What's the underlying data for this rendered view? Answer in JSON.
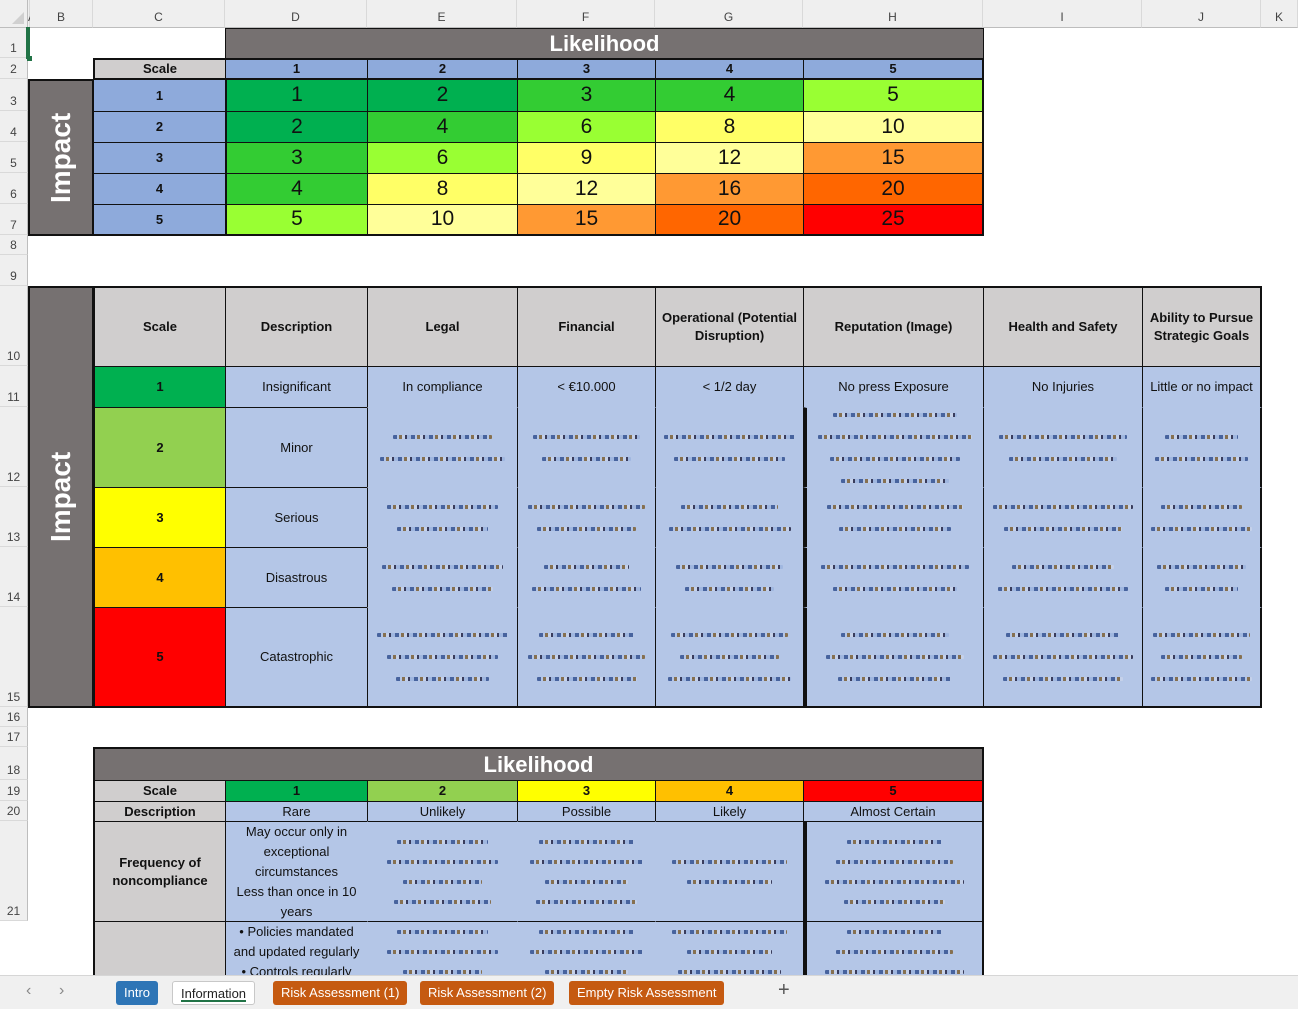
{
  "spreadsheet": {
    "columns": [
      "A",
      "B",
      "C",
      "D",
      "E",
      "F",
      "G",
      "H",
      "I",
      "J",
      "K"
    ],
    "rows": [
      "1",
      "2",
      "3",
      "4",
      "5",
      "6",
      "7",
      "8",
      "9",
      "10",
      "11",
      "12",
      "13",
      "14",
      "15",
      "16",
      "17",
      "18",
      "19",
      "20",
      "21"
    ],
    "selected_cell": "A1"
  },
  "risk_matrix": {
    "title": "Likelihood",
    "side_title": "Impact",
    "scale_label": "Scale",
    "likelihood_scale": [
      "1",
      "2",
      "3",
      "4",
      "5"
    ],
    "impact_scale": [
      "1",
      "2",
      "3",
      "4",
      "5"
    ],
    "values": [
      [
        "1",
        "2",
        "3",
        "4",
        "5"
      ],
      [
        "2",
        "4",
        "6",
        "8",
        "10"
      ],
      [
        "3",
        "6",
        "9",
        "12",
        "15"
      ],
      [
        "4",
        "8",
        "12",
        "16",
        "20"
      ],
      [
        "5",
        "10",
        "15",
        "20",
        "25"
      ]
    ],
    "colors": [
      [
        "#00b050",
        "#00b050",
        "#33cc33",
        "#33cc33",
        "#99ff33"
      ],
      [
        "#00b050",
        "#33cc33",
        "#99ff33",
        "#ffff66",
        "#ffff99"
      ],
      [
        "#33cc33",
        "#99ff33",
        "#ffff66",
        "#ffff99",
        "#ff9933"
      ],
      [
        "#33cc33",
        "#ffff66",
        "#ffff99",
        "#ff9933",
        "#ff6600"
      ],
      [
        "#99ff33",
        "#ffff99",
        "#ff9933",
        "#ff6600",
        "#ff0000"
      ]
    ]
  },
  "impact_table": {
    "side_title": "Impact",
    "headers": [
      "Scale",
      "Description",
      "Legal",
      "Financial",
      "Operational (Potential Disruption)",
      "Reputation (Image)",
      "Health and Safety",
      "Ability to Pursue Strategic Goals"
    ],
    "rows": [
      {
        "scale": "1",
        "color": "#00b050",
        "description": "Insignificant",
        "legal": "In compliance",
        "financial": "< €10.000",
        "operational": "< 1/2 day",
        "reputation": "No press Exposure",
        "health_safety": "No Injuries",
        "strategic": "Little or no impact"
      },
      {
        "scale": "2",
        "color": "#92d050",
        "description": "Minor"
      },
      {
        "scale": "3",
        "color": "#ffff00",
        "description": "Serious"
      },
      {
        "scale": "4",
        "color": "#ffc000",
        "description": "Disastrous"
      },
      {
        "scale": "5",
        "color": "#ff0000",
        "description": "Catastrophic"
      }
    ]
  },
  "likelihood_table": {
    "title": "Likelihood",
    "scale_label": "Scale",
    "description_label": "Description",
    "frequency_label": "Frequency of noncompliance",
    "levels": [
      {
        "scale": "1",
        "color": "#00b050",
        "description": "Rare",
        "frequency": "May occur only in exceptional circumstances\nLess than once in 10 years",
        "controls": "• Policies mandated and updated regularly\n• Controls regularly"
      },
      {
        "scale": "2",
        "color": "#92d050",
        "description": "Unlikely"
      },
      {
        "scale": "3",
        "color": "#ffff00",
        "description": "Possible"
      },
      {
        "scale": "4",
        "color": "#ffc000",
        "description": "Likely"
      },
      {
        "scale": "5",
        "color": "#ff0000",
        "description": "Almost Certain"
      }
    ]
  },
  "sheet_tabs": {
    "prev_label": "‹",
    "next_label": "›",
    "tabs": [
      {
        "label": "Intro",
        "style": "blue"
      },
      {
        "label": "Information",
        "style": "active"
      },
      {
        "label": "Risk Assessment (1)",
        "style": "orange"
      },
      {
        "label": "Risk Assessment (2)",
        "style": "orange"
      },
      {
        "label": "Empty Risk Assessment",
        "style": "orange"
      }
    ],
    "add_label": "+"
  }
}
